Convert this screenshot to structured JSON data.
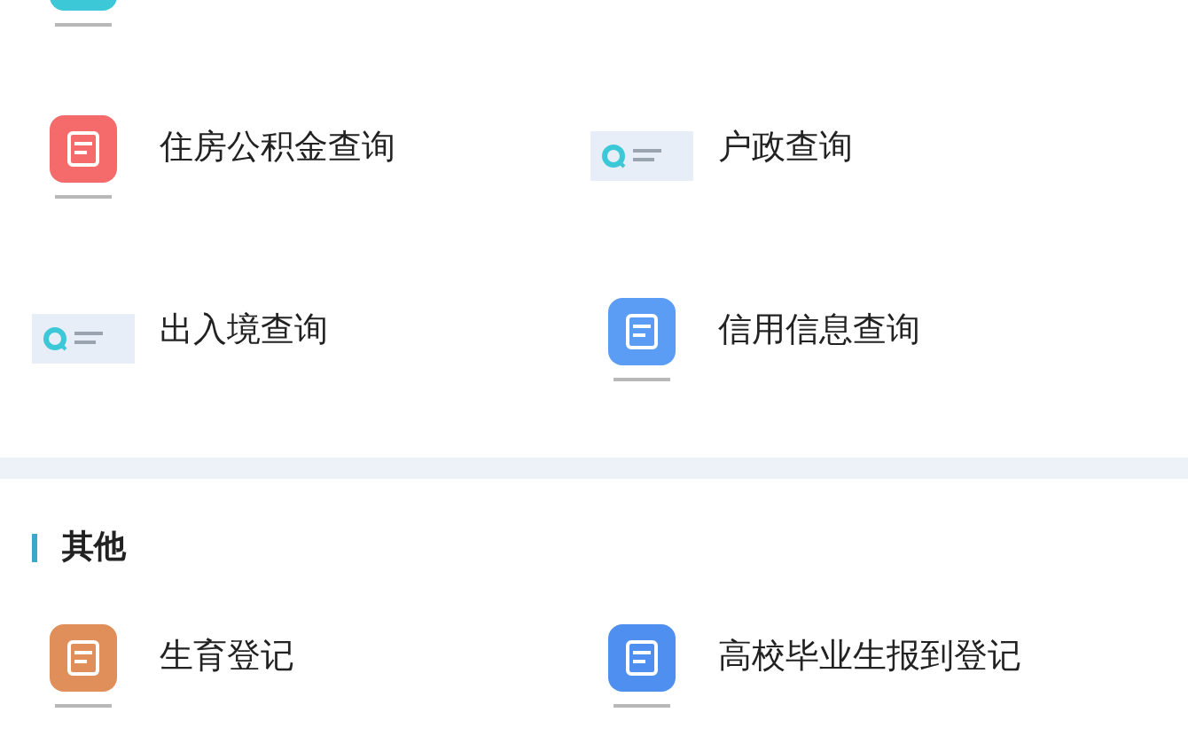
{
  "services": [
    {
      "title": "住房公积金查询",
      "kind": "tile",
      "color": "#f56b6b"
    },
    {
      "title": "户政查询",
      "kind": "banner"
    },
    {
      "title": "出入境查询",
      "kind": "banner"
    },
    {
      "title": "信用信息查询",
      "kind": "tile",
      "color": "#5b9cf5"
    }
  ],
  "section": {
    "title": "其他",
    "items": [
      {
        "title": "生育登记",
        "kind": "tile",
        "color": "#e08f5a"
      },
      {
        "title": "高校毕业生报到登记",
        "kind": "tile",
        "color": "#4f8ff0"
      }
    ]
  }
}
